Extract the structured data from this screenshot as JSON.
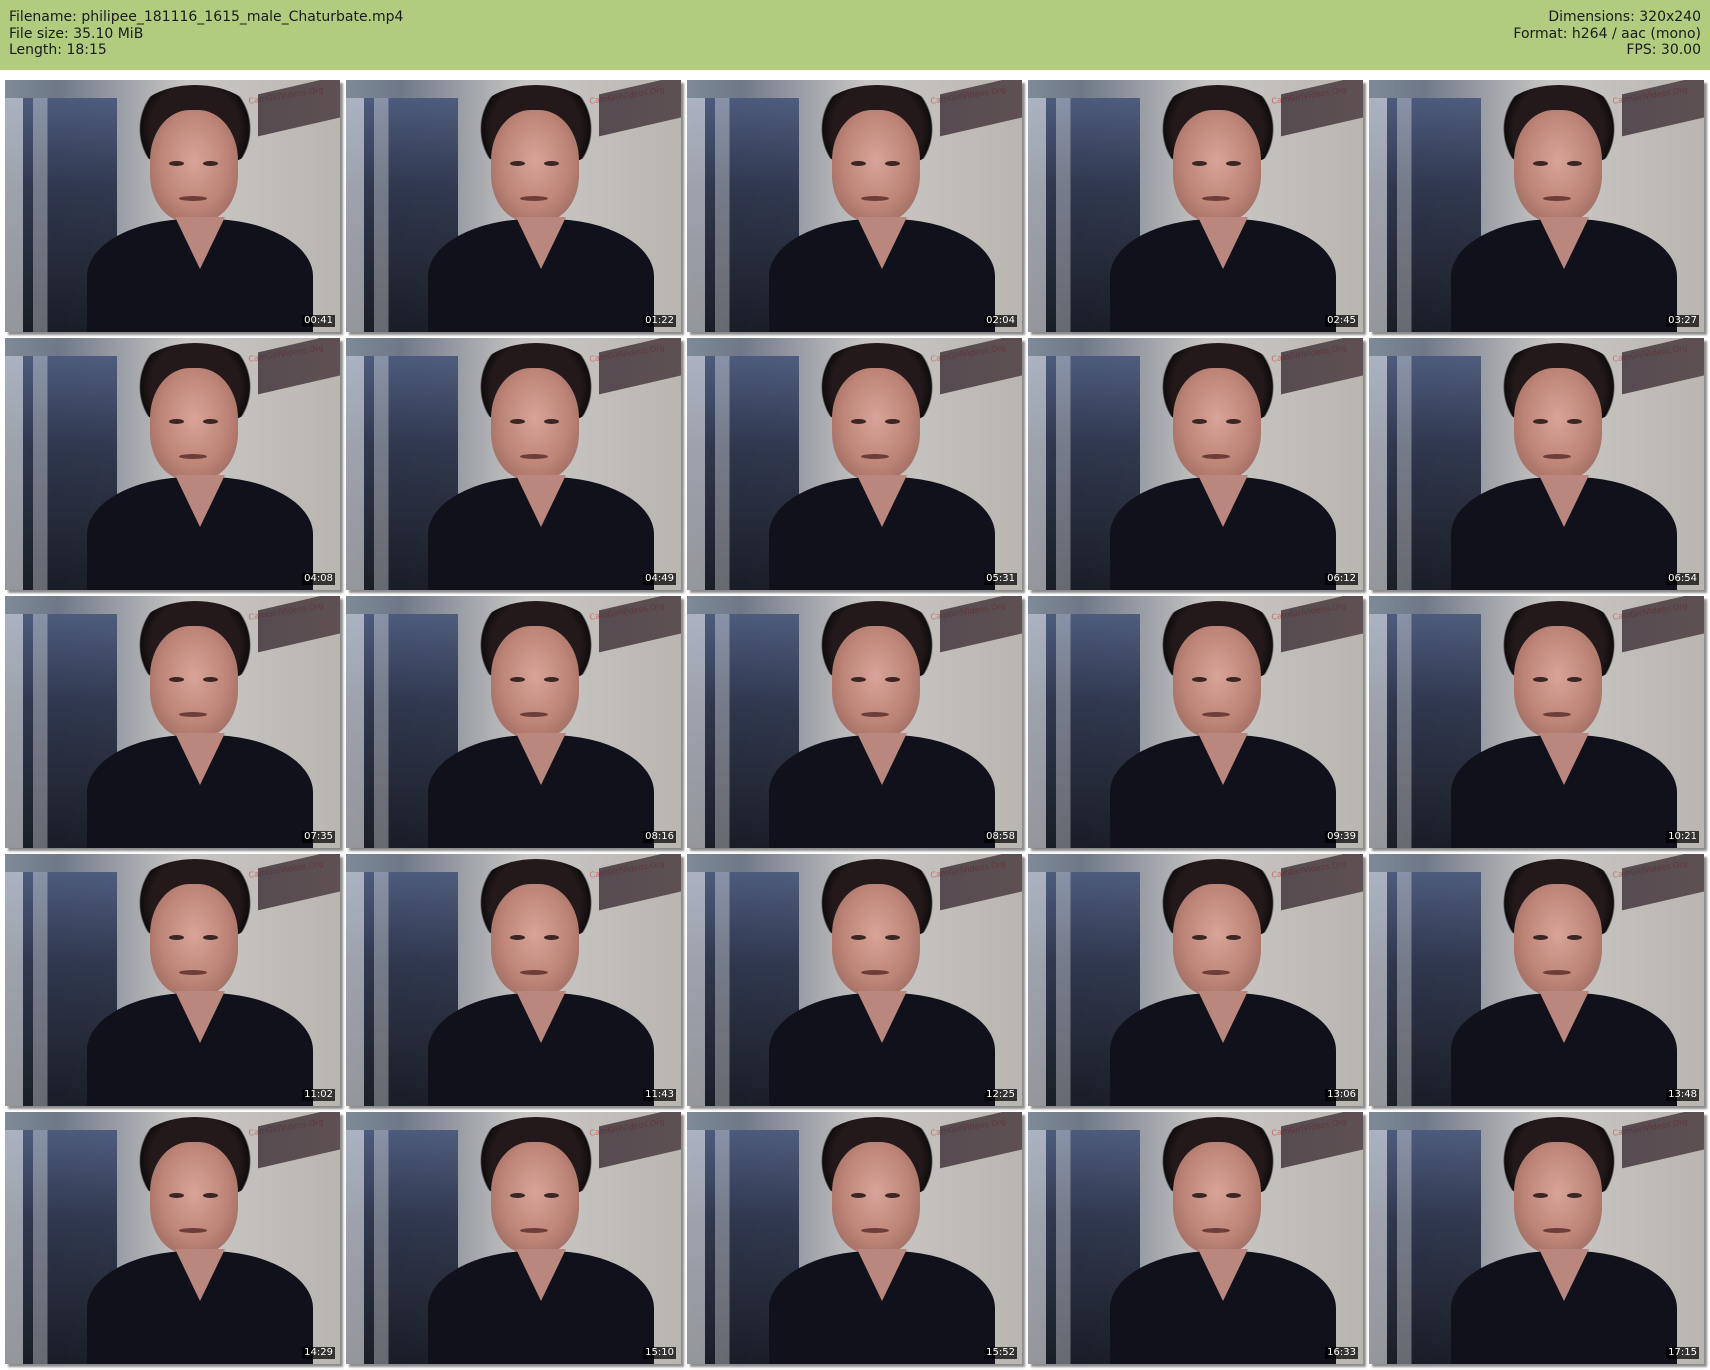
{
  "header": {
    "filename_label": "Filename:",
    "filename_value": "philipee_181116_1615_male_Chaturbate.mp4",
    "filesize_label": "File size:",
    "filesize_value": "35.10 MiB",
    "length_label": "Length:",
    "length_value": "18:15",
    "dimensions_label": "Dimensions:",
    "dimensions_value": "320x240",
    "format_label": "Format:",
    "format_value": "h264 / aac (mono)",
    "fps_label": "FPS:",
    "fps_value": "30.00"
  },
  "thumbnail_watermark": "CamGirlVideos.Org",
  "thumbnails": [
    "00:41",
    "01:22",
    "02:04",
    "02:45",
    "03:27",
    "04:08",
    "04:49",
    "05:31",
    "06:12",
    "06:54",
    "07:35",
    "08:16",
    "08:58",
    "09:39",
    "10:21",
    "11:02",
    "11:43",
    "12:25",
    "13:06",
    "13:48",
    "14:29",
    "15:10",
    "15:52",
    "16:33",
    "17:15"
  ],
  "colors": {
    "header_background": "#b1cc7e",
    "header_text": "#1b1b1b",
    "timestamp_background": "#000000",
    "timestamp_text": "#ffffff",
    "page_background": "#ffffff"
  }
}
